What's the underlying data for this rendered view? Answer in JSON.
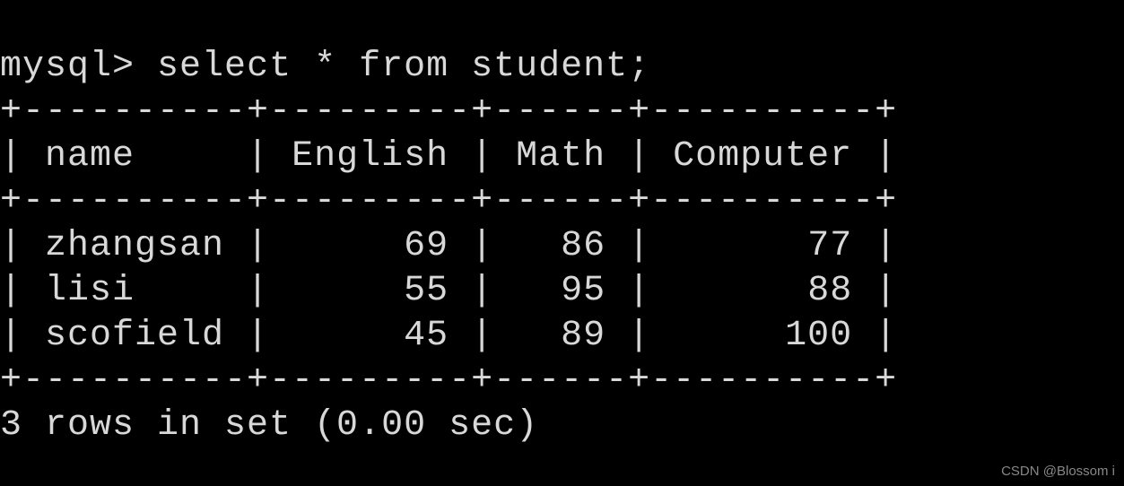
{
  "prompt": "mysql>",
  "query": "select * from student;",
  "table": {
    "headers": [
      "name",
      "English",
      "Math",
      "Computer"
    ],
    "rows": [
      {
        "name": "zhangsan",
        "English": 69,
        "Math": 86,
        "Computer": 77
      },
      {
        "name": "lisi",
        "English": 55,
        "Math": 95,
        "Computer": 88
      },
      {
        "name": "scofield",
        "English": 45,
        "Math": 89,
        "Computer": 100
      }
    ]
  },
  "status": "3 rows in set (0.00 sec)",
  "watermark": "CSDN @Blossom i",
  "chart_data": {
    "type": "table",
    "title": "student",
    "columns": [
      "name",
      "English",
      "Math",
      "Computer"
    ],
    "data": [
      [
        "zhangsan",
        69,
        86,
        77
      ],
      [
        "lisi",
        55,
        95,
        88
      ],
      [
        "scofield",
        45,
        89,
        100
      ]
    ]
  }
}
